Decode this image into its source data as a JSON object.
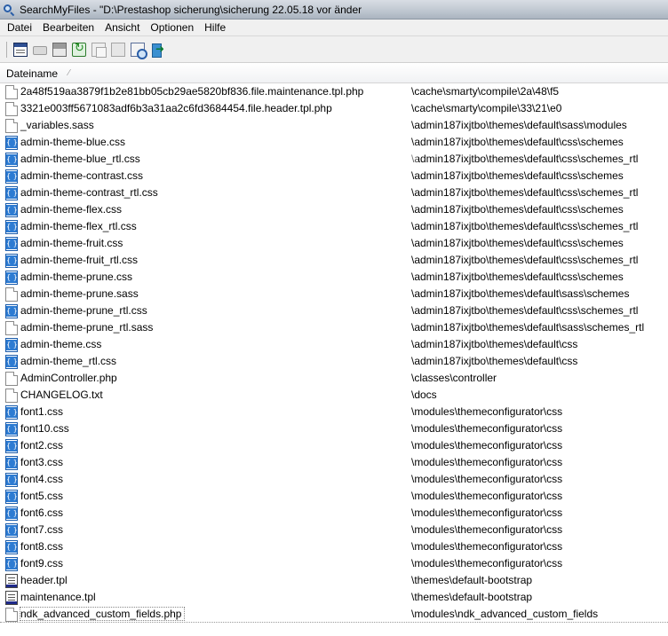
{
  "window": {
    "title": "SearchMyFiles -  \"D:\\Prestashop sicherung\\sicherung 22.05.18 vor änder"
  },
  "menu": [
    "Datei",
    "Bearbeiten",
    "Ansicht",
    "Optionen",
    "Hilfe"
  ],
  "toolbar": {
    "icons": [
      "search-options-icon",
      "drive-icon",
      "save-icon",
      "refresh-icon",
      "copy-icon",
      "paste-icon",
      "properties-icon",
      "exit-icon"
    ]
  },
  "list": {
    "columns": {
      "name": "Dateiname"
    },
    "rows": [
      {
        "name": "2a48f519aa3879f1b2e81bb05cb29ae5820bf836.file.maintenance.tpl.php",
        "path": "\\cache\\smarty\\compile\\2a\\48\\f5",
        "icon": "doc"
      },
      {
        "name": "3321e003ff5671083adf6b3a31aa2c6fd3684454.file.header.tpl.php",
        "path": "\\cache\\smarty\\compile\\33\\21\\e0",
        "icon": "doc"
      },
      {
        "name": "_variables.sass",
        "path": "\\admin187ixjtbo\\themes\\default\\sass\\modules",
        "icon": "doc"
      },
      {
        "name": "admin-theme-blue.css",
        "path": "\\admin187ixjtbo\\themes\\default\\css\\schemes",
        "icon": "css"
      },
      {
        "name": "admin-theme-blue_rtl.css",
        "path": "\\admin187ixjtbo\\themes\\default\\css\\schemes_rtl",
        "icon": "css"
      },
      {
        "name": "admin-theme-contrast.css",
        "path": "\\admin187ixjtbo\\themes\\default\\css\\schemes",
        "icon": "css"
      },
      {
        "name": "admin-theme-contrast_rtl.css",
        "path": "\\admin187ixjtbo\\themes\\default\\css\\schemes_rtl",
        "icon": "css"
      },
      {
        "name": "admin-theme-flex.css",
        "path": "\\admin187ixjtbo\\themes\\default\\css\\schemes",
        "icon": "css"
      },
      {
        "name": "admin-theme-flex_rtl.css",
        "path": "\\admin187ixjtbo\\themes\\default\\css\\schemes_rtl",
        "icon": "css"
      },
      {
        "name": "admin-theme-fruit.css",
        "path": "\\admin187ixjtbo\\themes\\default\\css\\schemes",
        "icon": "css"
      },
      {
        "name": "admin-theme-fruit_rtl.css",
        "path": "\\admin187ixjtbo\\themes\\default\\css\\schemes_rtl",
        "icon": "css"
      },
      {
        "name": "admin-theme-prune.css",
        "path": "\\admin187ixjtbo\\themes\\default\\css\\schemes",
        "icon": "css"
      },
      {
        "name": "admin-theme-prune.sass",
        "path": "\\admin187ixjtbo\\themes\\default\\sass\\schemes",
        "icon": "doc"
      },
      {
        "name": "admin-theme-prune_rtl.css",
        "path": "\\admin187ixjtbo\\themes\\default\\css\\schemes_rtl",
        "icon": "css"
      },
      {
        "name": "admin-theme-prune_rtl.sass",
        "path": "\\admin187ixjtbo\\themes\\default\\sass\\schemes_rtl",
        "icon": "doc"
      },
      {
        "name": "admin-theme.css",
        "path": "\\admin187ixjtbo\\themes\\default\\css",
        "icon": "css"
      },
      {
        "name": "admin-theme_rtl.css",
        "path": "\\admin187ixjtbo\\themes\\default\\css",
        "icon": "css"
      },
      {
        "name": "AdminController.php",
        "path": "\\classes\\controller",
        "icon": "doc"
      },
      {
        "name": "CHANGELOG.txt",
        "path": "\\docs",
        "icon": "doc"
      },
      {
        "name": "font1.css",
        "path": "\\modules\\themeconfigurator\\css",
        "icon": "css"
      },
      {
        "name": "font10.css",
        "path": "\\modules\\themeconfigurator\\css",
        "icon": "css"
      },
      {
        "name": "font2.css",
        "path": "\\modules\\themeconfigurator\\css",
        "icon": "css"
      },
      {
        "name": "font3.css",
        "path": "\\modules\\themeconfigurator\\css",
        "icon": "css"
      },
      {
        "name": "font4.css",
        "path": "\\modules\\themeconfigurator\\css",
        "icon": "css"
      },
      {
        "name": "font5.css",
        "path": "\\modules\\themeconfigurator\\css",
        "icon": "css"
      },
      {
        "name": "font6.css",
        "path": "\\modules\\themeconfigurator\\css",
        "icon": "css"
      },
      {
        "name": "font7.css",
        "path": "\\modules\\themeconfigurator\\css",
        "icon": "css"
      },
      {
        "name": "font8.css",
        "path": "\\modules\\themeconfigurator\\css",
        "icon": "css"
      },
      {
        "name": "font9.css",
        "path": "\\modules\\themeconfigurator\\css",
        "icon": "css"
      },
      {
        "name": "header.tpl",
        "path": "\\themes\\default-bootstrap",
        "icon": "tpl"
      },
      {
        "name": "maintenance.tpl",
        "path": "\\themes\\default-bootstrap",
        "icon": "tpl"
      },
      {
        "name": "ndk_advanced_custom_fields.php",
        "path": "\\modules\\ndk_advanced_custom_fields",
        "icon": "doc",
        "focused": true
      }
    ]
  }
}
